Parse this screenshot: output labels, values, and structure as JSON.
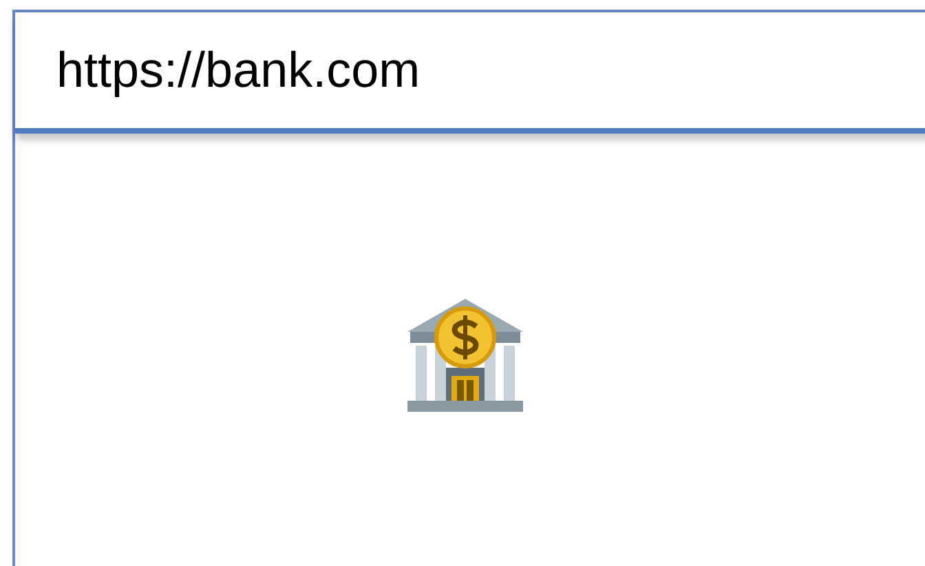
{
  "address_bar": {
    "url": "https://bank.com"
  }
}
